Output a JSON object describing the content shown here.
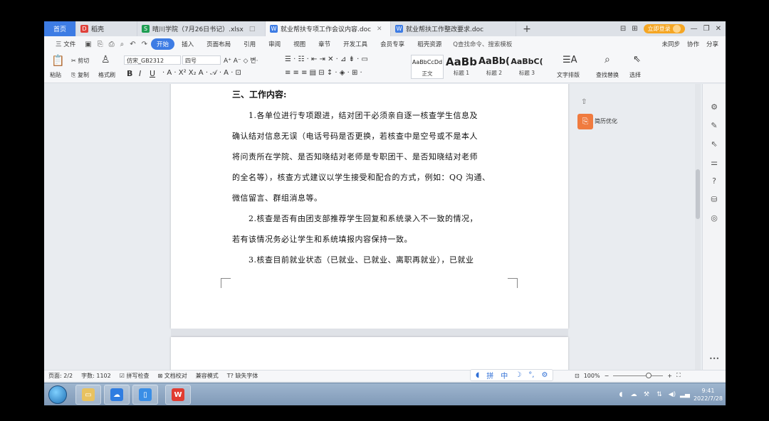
{
  "tabs": [
    {
      "label": "首页",
      "kind": "home"
    },
    {
      "label": "稻壳",
      "icon": "daoke-icon",
      "color": "#e0413a"
    },
    {
      "label": "晴川学院（7月26日书记）.xlsx",
      "icon": "xlsx-icon",
      "color": "#1e9e52"
    },
    {
      "label": "就业帮扶专项工作会议内容.doc",
      "icon": "doc-icon",
      "color": "#3d7ce4",
      "active": true
    },
    {
      "label": "就业帮扶工作整改要求.doc",
      "icon": "doc-icon",
      "color": "#3d7ce4"
    }
  ],
  "titlebar": {
    "new_tab": "+",
    "login": "立即登录"
  },
  "menu": {
    "file": "三 文件",
    "items": [
      "开始",
      "插入",
      "页面布局",
      "引用",
      "审阅",
      "视图",
      "章节",
      "开发工具",
      "会员专享",
      "稻壳资源"
    ],
    "search": "Q查找命令、搜索模板",
    "right": [
      "未同步",
      "协作",
      "分享"
    ]
  },
  "ribbon": {
    "paste": "粘贴",
    "cut": "剪切",
    "copy": "复制",
    "format_painter": "格式刷",
    "font_name": "仿宋_GB2312",
    "font_size": "四号",
    "styles": [
      {
        "preview": "AaBbCcDd",
        "label": "正文"
      },
      {
        "preview": "AaBb",
        "label": "标题 1"
      },
      {
        "preview": "AaBb(",
        "label": "标题 2"
      },
      {
        "preview": "AaBbC(",
        "label": "标题 3"
      }
    ],
    "text_layout": "文字排版",
    "find_replace": "查找替换",
    "select": "选择"
  },
  "document": {
    "heading": "三、工作内容:",
    "lines": [
      "　　1.各单位进行专项跟进，结对团干必须亲自逐一核查学生信息及",
      "确认结对信息无误（电话号码是否更换，若核查中是空号或不是本人",
      "将问责所在学院、是否知晓结对老师是专职团干、是否知晓结对老师",
      "的全名等），核查方式建议以学生接受和配合的方式，例如：QQ 沟通、",
      "微信留言、群组消息等。",
      "　　2.核查是否有由团支部推荐学生回复和系统录入不一致的情况，",
      "若有该情况务必让学生和系统填报内容保持一致。",
      "　　3.核查目前就业状态（已就业、已就业、离职再就业），已就业"
    ]
  },
  "side_panel": {
    "label": "简历优化"
  },
  "status": {
    "page": "页面: 2/2",
    "words": "字数: 1102",
    "spell": "拼写检查",
    "proof": "文档校对",
    "compat": "兼容模式",
    "missing_font": "缺失字体",
    "zoom": "100%"
  },
  "ime": {
    "items": [
      "拼",
      "中",
      "°,"
    ]
  },
  "clock": {
    "time": "9:41",
    "date": "2022/7/28"
  }
}
